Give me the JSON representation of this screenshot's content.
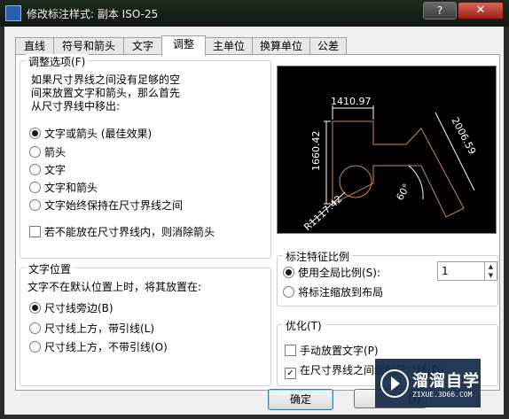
{
  "window": {
    "title": "修改标注样式: 副本 ISO-25",
    "help": "?",
    "close": "✕"
  },
  "tabs": [
    {
      "label": "直线"
    },
    {
      "label": "符号和箭头"
    },
    {
      "label": "文字"
    },
    {
      "label": "调整",
      "active": true
    },
    {
      "label": "主单位"
    },
    {
      "label": "换算单位"
    },
    {
      "label": "公差"
    }
  ],
  "fit_options": {
    "legend": "调整选项(F)",
    "description": [
      "如果尺寸界线之间没有足够的空",
      "间来放置文字和箭头，那么首先",
      "从尺寸界线中移出:"
    ],
    "radios": [
      {
        "label": "文字或箭头 (最佳效果)",
        "checked": true
      },
      {
        "label": "箭头",
        "checked": false
      },
      {
        "label": "文字",
        "checked": false
      },
      {
        "label": "文字和箭头",
        "checked": false
      },
      {
        "label": "文字始终保持在尺寸界线之间",
        "checked": false
      }
    ],
    "suppress_checkbox": {
      "label": "若不能放在尺寸界线内，则消除箭头",
      "checked": false
    }
  },
  "text_placement": {
    "legend": "文字位置",
    "description": "文字不在默认位置上时，将其放置在:",
    "radios": [
      {
        "label": "尺寸线旁边(B)",
        "checked": true
      },
      {
        "label": "尺寸线上方，带引线(L)",
        "checked": false
      },
      {
        "label": "尺寸线上方，不带引线(O)",
        "checked": false
      }
    ]
  },
  "preview": {
    "dim_top": "1410.97",
    "dim_left": "1660.42",
    "dim_aligned": "2006.59",
    "dim_angle": "60°",
    "dim_radius": "R1117.42",
    "colors": {
      "background": "#000000",
      "geometry": "#d4874a",
      "dimensions": "#ffffff"
    }
  },
  "scale": {
    "legend": "标注特征比例",
    "use_global": {
      "label": "使用全局比例(S):",
      "checked": true
    },
    "global_value": "1",
    "scale_to_layout": {
      "label": "将标注缩放到布局",
      "checked": false
    }
  },
  "fine_tuning": {
    "legend": "优化(T)",
    "manual_text": {
      "label": "手动放置文字(P)",
      "checked": false
    },
    "draw_dimline": {
      "label": "在尺寸界线之间绘制尺寸线(D)",
      "checked": true
    }
  },
  "buttons": {
    "ok": "确定",
    "partial": "D)"
  },
  "watermark": {
    "brand": "溜溜自学",
    "url": "ZIXUE.3D66.COM"
  }
}
